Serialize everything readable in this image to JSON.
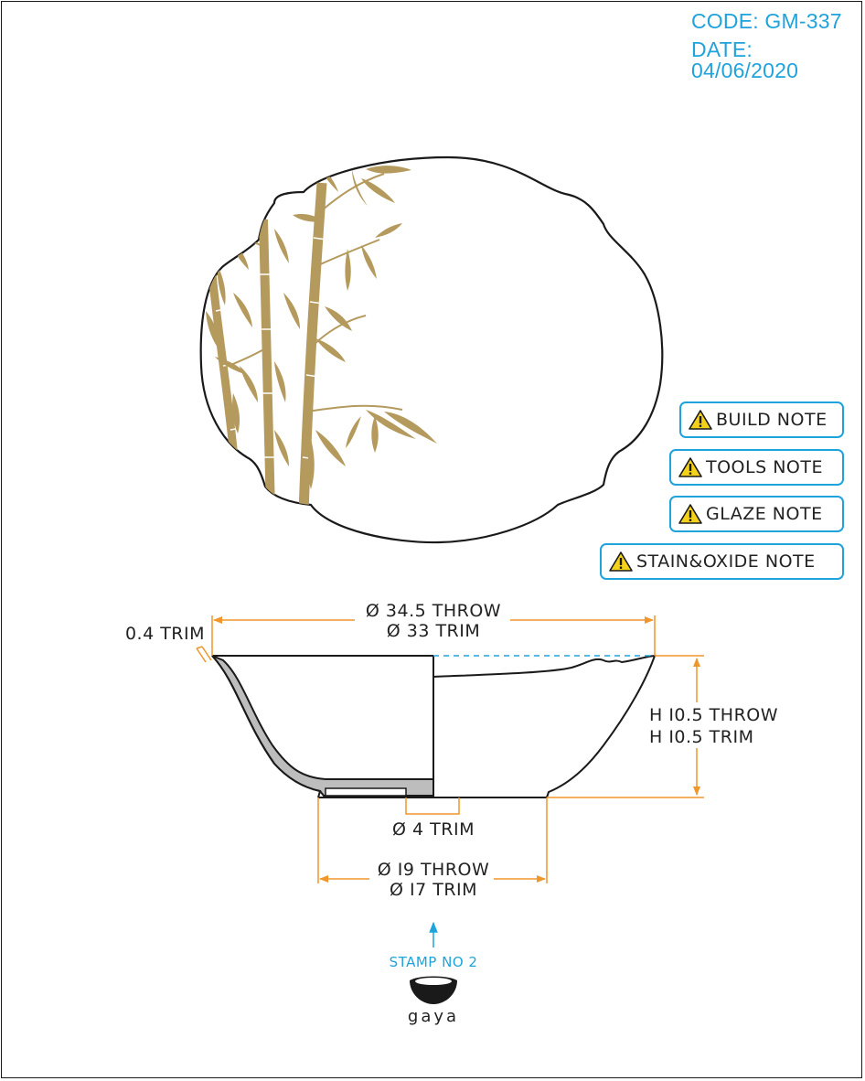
{
  "header": {
    "code": "CODE: GM-337",
    "date": "DATE: 04/06/2020"
  },
  "notes": [
    {
      "label": "BUILD NOTE",
      "icon": "warning-icon"
    },
    {
      "label": "TOOLS NOTE",
      "icon": "warning-icon"
    },
    {
      "label": "GLAZE NOTE",
      "icon": "warning-icon"
    },
    {
      "label": "STAIN&OXIDE NOTE",
      "icon": "warning-icon"
    }
  ],
  "dimensions": {
    "rim_throw": "Ø 34.5 THROW",
    "rim_trim": "Ø 33 TRIM",
    "wall_trim": "0.4 TRIM",
    "height_throw": "H I0.5 THROW",
    "height_trim": "H I0.5 TRIM",
    "foot_inner": "Ø 4 TRIM",
    "foot_throw": "Ø I9 THROW",
    "foot_trim": "Ø I7 TRIM"
  },
  "stamp": {
    "label": "STAMP NO 2",
    "logo_text": "gaya"
  },
  "colors": {
    "accent_blue": "#1fa3dc",
    "dimension_orange": "#f0962a",
    "bamboo_gold": "#b59a5e",
    "outline": "#1a1a1a",
    "wall_gray": "#bdbdbd",
    "warning_yellow": "#f5d21a"
  }
}
